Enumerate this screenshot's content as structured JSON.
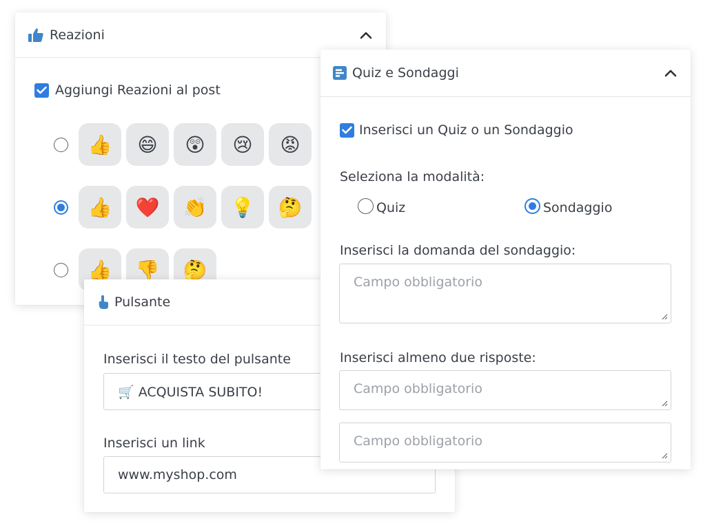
{
  "reactions": {
    "title": "Reazioni",
    "add_label": "Aggiungi Reazioni al post",
    "sets": [
      {
        "emojis": [
          "👍",
          "😄",
          "😲",
          "😢",
          "😡"
        ],
        "selected": false
      },
      {
        "emojis": [
          "👍",
          "❤️",
          "👏",
          "💡",
          "🤔"
        ],
        "selected": true
      },
      {
        "emojis": [
          "👍",
          "👎",
          "🤔"
        ],
        "selected": false
      }
    ]
  },
  "button_panel": {
    "title": "Pulsante",
    "text_label": "Inserisci il testo del pulsante",
    "text_value": "🛒 ACQUISTA SUBITO!",
    "link_label": "Inserisci un link",
    "link_value": "www.myshop.com"
  },
  "quiz": {
    "title": "Quiz e Sondaggi",
    "insert_label": "Inserisci un Quiz o un Sondaggio",
    "mode_label": "Seleziona la modalità:",
    "mode_options": [
      {
        "label": "Quiz",
        "selected": false
      },
      {
        "label": "Sondaggio",
        "selected": true
      }
    ],
    "question_label": "Inserisci la domanda del sondaggio:",
    "question_placeholder": "Campo obbligatorio",
    "answers_label": "Inserisci almeno due risposte:",
    "answer_placeholders": [
      "Campo obbligatorio",
      "Campo obbligatorio"
    ]
  },
  "colors": {
    "accent": "#2f7de1",
    "chip": "#e6e7e9",
    "text": "#3a3f47",
    "placeholder": "#9ca1a8"
  }
}
